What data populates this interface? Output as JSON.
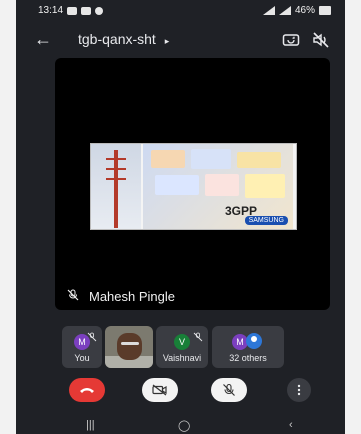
{
  "status_bar": {
    "time": "13:14",
    "battery_text": "46%"
  },
  "app_bar": {
    "back_icon": "back-arrow-icon",
    "meeting_code": "tgb-qanx-sht",
    "caret_icon": "chevron-right-icon",
    "switch_camera_icon": "switch-camera-icon",
    "audio_output_icon": "volume-off-icon"
  },
  "main_stage": {
    "speaker_name": "Mahesh Pingle",
    "speaker_mic_icon": "mic-off-icon",
    "slide_brand_label": "3GPP",
    "slide_partner_label": "SAMSUNG"
  },
  "participants": [
    {
      "initial": "M",
      "name": "You",
      "avatar_color": "#7b3fbf",
      "muted": true
    },
    {
      "initial": "",
      "name": "",
      "avatar_color": "",
      "muted": false
    },
    {
      "initial": "V",
      "name": "Vaishnavi",
      "avatar_color": "#188038",
      "muted": true
    },
    {
      "initial": "M",
      "name": "32 others",
      "avatar_color": "#7b3fbf",
      "muted": false
    }
  ],
  "controls": {
    "hangup_icon": "phone-hangup-icon",
    "camera_icon": "camera-off-icon",
    "mic_icon": "mic-off-icon",
    "more_icon": "more-vertical-icon"
  },
  "nav": {
    "recent_icon": "recent-apps-icon",
    "home_icon": "home-icon",
    "back_icon": "back-icon"
  }
}
